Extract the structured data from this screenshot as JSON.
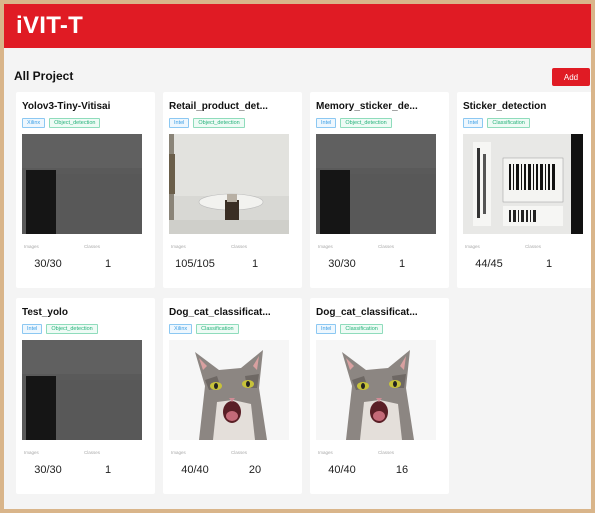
{
  "header": {
    "brand": "iVIT-T"
  },
  "page": {
    "title": "All Project",
    "add_label": "Add"
  },
  "projects": [
    {
      "name": "Yolov3-Tiny-Vitisai",
      "tags": [
        "Xilinx",
        "Object_detection"
      ],
      "labels": [
        "Images",
        "Classes"
      ],
      "images": "30/30",
      "classes": "1",
      "thumb": "dark-scene"
    },
    {
      "name": "Retail_product_det...",
      "tags": [
        "Intel",
        "Object_detection"
      ],
      "labels": [
        "Images",
        "Classes"
      ],
      "images": "105/105",
      "classes": "1",
      "thumb": "turntable-scene"
    },
    {
      "name": "Memory_sticker_de...",
      "tags": [
        "Intel",
        "Object_detection"
      ],
      "labels": [
        "Images",
        "Classes"
      ],
      "images": "30/30",
      "classes": "1",
      "thumb": "dark-scene"
    },
    {
      "name": "Sticker_detection",
      "tags": [
        "Intel",
        "Classification"
      ],
      "labels": [
        "Images",
        "Classes"
      ],
      "images": "44/45",
      "classes": "1",
      "thumb": "barcode-sticker"
    },
    {
      "name": "Test_yolo",
      "tags": [
        "Intel",
        "Object_detection"
      ],
      "labels": [
        "Images",
        "Classes"
      ],
      "images": "30/30",
      "classes": "1",
      "thumb": "dark-scene"
    },
    {
      "name": "Dog_cat_classificat...",
      "tags": [
        "Xilinx",
        "Classification"
      ],
      "labels": [
        "Images",
        "Classes"
      ],
      "images": "40/40",
      "classes": "20",
      "thumb": "cat-photo"
    },
    {
      "name": "Dog_cat_classificat...",
      "tags": [
        "Intel",
        "Classification"
      ],
      "labels": [
        "Images",
        "Classes"
      ],
      "images": "40/40",
      "classes": "16",
      "thumb": "cat-photo"
    }
  ],
  "colors": {
    "accent": "#e01b24",
    "tag_blue": "#3b9fe6",
    "tag_green": "#25b27a"
  }
}
